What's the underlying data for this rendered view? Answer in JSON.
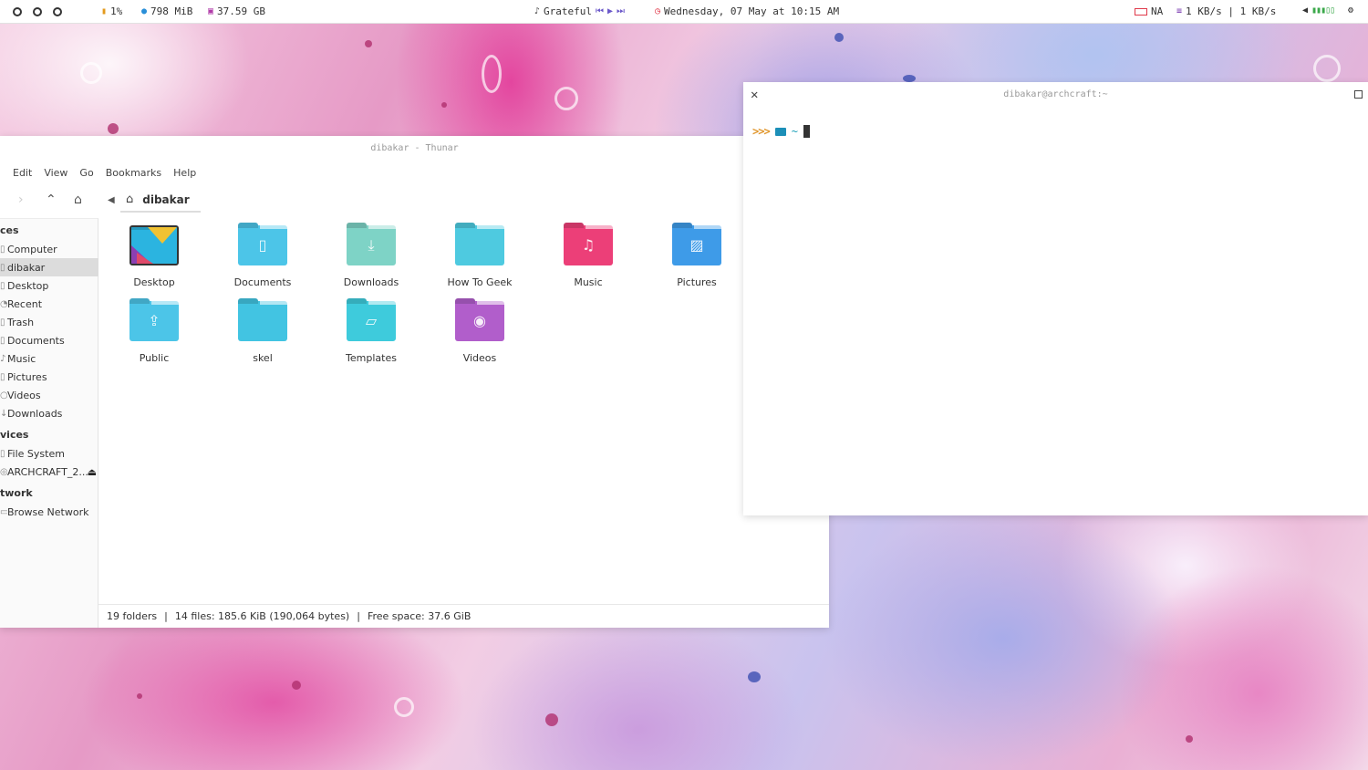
{
  "topbar": {
    "cpu": "1%",
    "memory": "798 MiB",
    "disk": "37.59 GB",
    "music_track": "Grateful",
    "datetime": "Wednesday, 07 May at 10:15 AM",
    "battery": "NA",
    "network": "1 KB/s | 1 KB/s",
    "icons": [
      "cpu-icon",
      "memory-icon",
      "disk-icon",
      "music-icon",
      "clock-icon",
      "battery-icon",
      "network-icon",
      "volume-icon",
      "settings-icon"
    ]
  },
  "thunar": {
    "title": "dibakar - Thunar",
    "menu": [
      "Edit",
      "View",
      "Go",
      "Bookmarks",
      "Help"
    ],
    "location": "dibakar",
    "sidebar": {
      "places_header": "ces",
      "places": [
        "Computer",
        "dibakar",
        "Desktop",
        "Recent",
        "Trash",
        "Documents",
        "Music",
        "Pictures",
        "Videos",
        "Downloads"
      ],
      "devices_header": "vices",
      "devices": [
        "File System",
        "ARCHCRAFT_2..."
      ],
      "network_header": "twork",
      "network": [
        "Browse Network"
      ]
    },
    "items": [
      {
        "label": "Desktop",
        "color": "#2bb4e0"
      },
      {
        "label": "Documents",
        "color": "#4cc5e8"
      },
      {
        "label": "Downloads",
        "color": "#7ed3c6"
      },
      {
        "label": "How To Geek",
        "color": "#4ecae0"
      },
      {
        "label": "Music",
        "color": "#ec3f78"
      },
      {
        "label": "Pictures",
        "color": "#3e9be8"
      },
      {
        "label": "Public",
        "color": "#4cc5e8"
      },
      {
        "label": "skel",
        "color": "#42c4e2"
      },
      {
        "label": "Templates",
        "color": "#3ecbdc"
      },
      {
        "label": "Videos",
        "color": "#b15ecb"
      }
    ],
    "status": {
      "folders": "19 folders",
      "files": "14 files: 185.6 KiB (190,064 bytes)",
      "free": "Free space: 37.6 GiB",
      "sep": "|"
    }
  },
  "terminal": {
    "title": "dibakar@archcraft:~",
    "prompt_arrows": ">>>",
    "prompt_dir": "~"
  }
}
